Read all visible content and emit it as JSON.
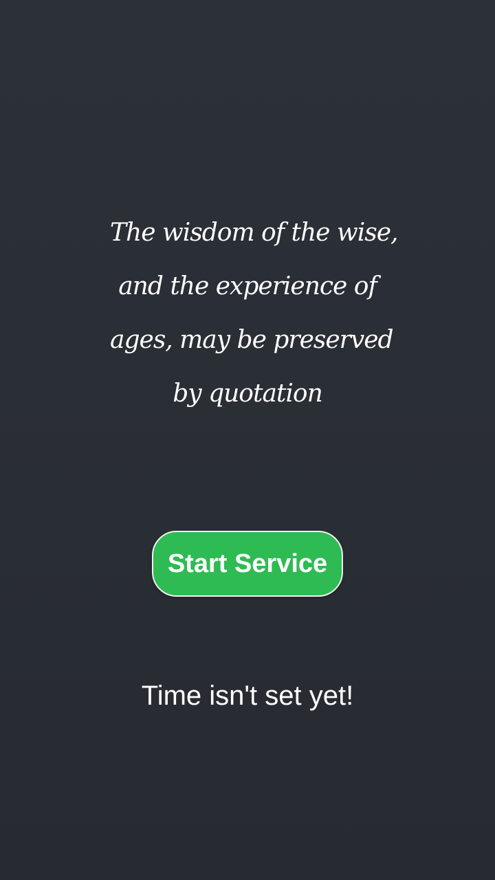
{
  "quote": {
    "lines": [
      "The wisdom of the wise,",
      "and the experience of",
      "ages, may be preserved",
      "by quotation"
    ]
  },
  "actions": {
    "start_label": "Start Service"
  },
  "status": {
    "text": "Time isn't set yet!"
  },
  "colors": {
    "background": "#2a2e35",
    "button": "#2fbb54",
    "text": "#ffffff"
  }
}
